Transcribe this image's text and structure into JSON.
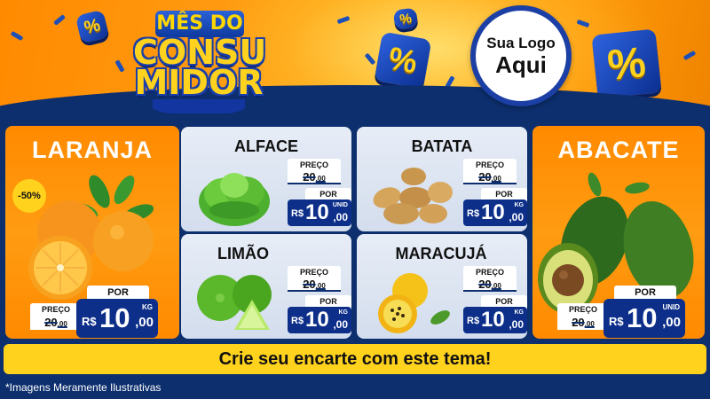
{
  "banner": {
    "title_line1": "MÊS DO",
    "title_line2": "CONSU",
    "title_line3": "MIDOR",
    "logo_line1": "Sua Logo",
    "logo_line2": "Aqui",
    "percent_symbol": "%"
  },
  "products": {
    "laranja": {
      "name": "LARANJA",
      "discount": "-50%",
      "preco_label": "PREÇO",
      "old_int": "20",
      "old_dec": ",00",
      "por_label": "POR",
      "currency": "R$",
      "new_int": "10",
      "new_dec": ",00",
      "unit": "KG"
    },
    "alface": {
      "name": "ALFACE",
      "preco_label": "PREÇO",
      "old_int": "20",
      "old_dec": ",00",
      "por_label": "POR",
      "currency": "R$",
      "new_int": "10",
      "new_dec": ",00",
      "unit": "UNID"
    },
    "batata": {
      "name": "BATATA",
      "preco_label": "PREÇO",
      "old_int": "20",
      "old_dec": ",00",
      "por_label": "POR",
      "currency": "R$",
      "new_int": "10",
      "new_dec": ",00",
      "unit": "KG"
    },
    "limao": {
      "name": "LIMÃO",
      "preco_label": "PREÇO",
      "old_int": "20",
      "old_dec": ",00",
      "por_label": "POR",
      "currency": "R$",
      "new_int": "10",
      "new_dec": ",00",
      "unit": "KG"
    },
    "maracuja": {
      "name": "MARACUJÁ",
      "preco_label": "PREÇO",
      "old_int": "20",
      "old_dec": ",00",
      "por_label": "POR",
      "currency": "R$",
      "new_int": "10",
      "new_dec": ",00",
      "unit": "KG"
    },
    "abacate": {
      "name": "ABACATE",
      "preco_label": "PREÇO",
      "old_int": "20",
      "old_dec": ",00",
      "por_label": "POR",
      "currency": "R$",
      "new_int": "10",
      "new_dec": ",00",
      "unit": "UNID"
    }
  },
  "cta": "Crie seu encarte com este tema!",
  "footer": "*Imagens Meramente Ilustrativas",
  "colors": {
    "orange": "#ff8a00",
    "navy": "#0d2f6e",
    "price_blue": "#0d2f8a",
    "yellow": "#ffd21e",
    "panel_light": "#e2e9f4"
  }
}
